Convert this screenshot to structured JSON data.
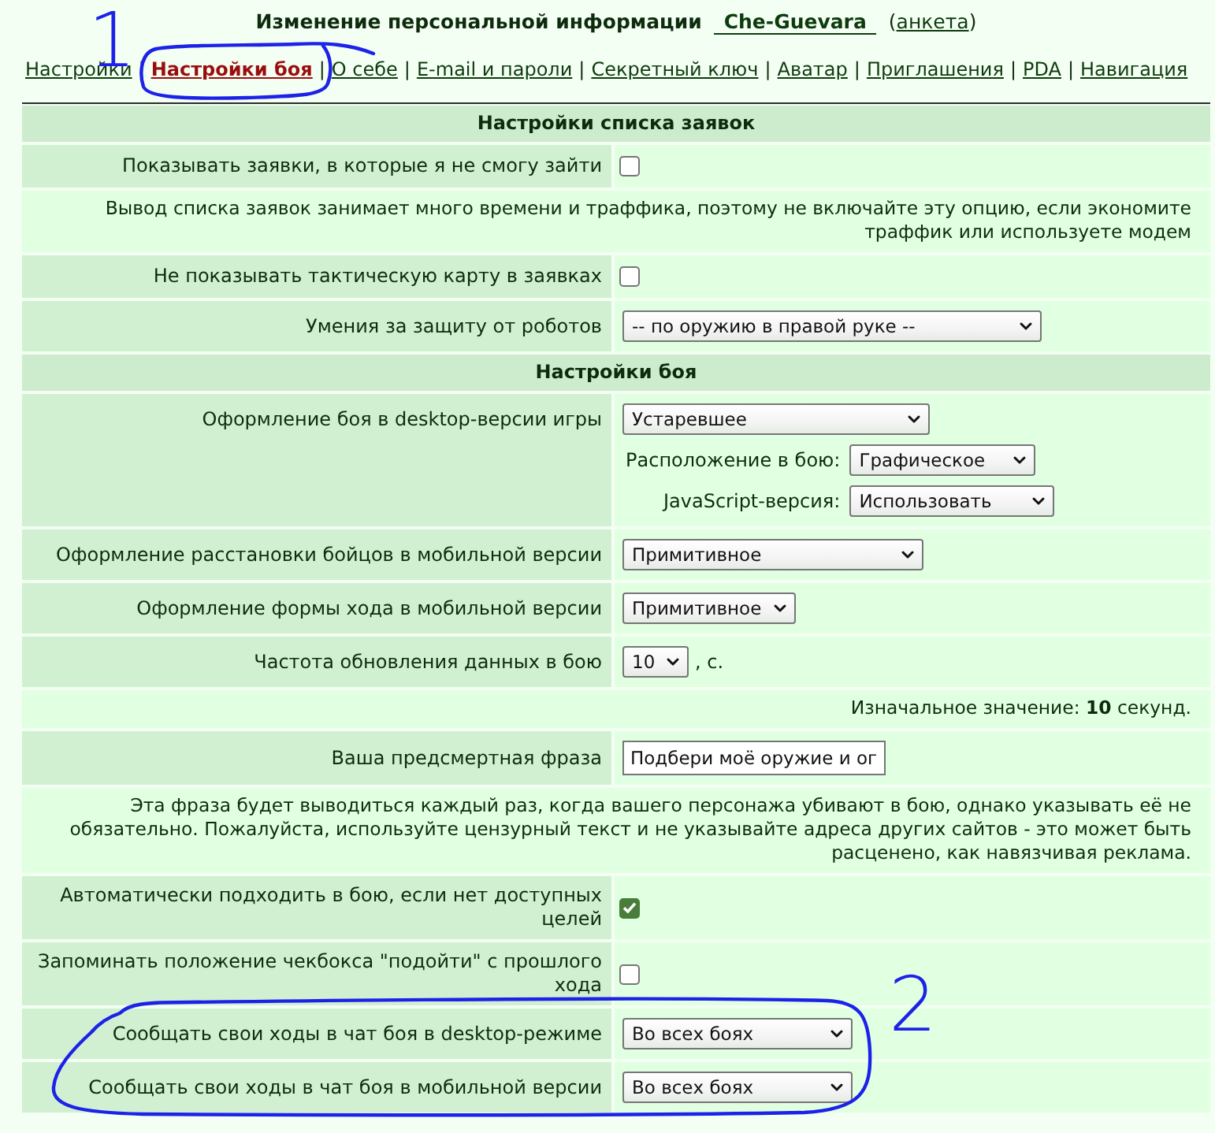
{
  "header": {
    "title": "Изменение персональной информации",
    "user_link": "Che-Guevara",
    "profile": {
      "open": "(",
      "link": "анкета",
      "close": ")"
    }
  },
  "nav": {
    "separator": "|",
    "items": [
      {
        "label": "Настройки",
        "selected": false
      },
      {
        "label": "Настройки боя",
        "selected": true,
        "annotation": "1"
      },
      {
        "label": "О себе",
        "selected": false
      },
      {
        "label": "E-mail и пароли",
        "selected": false
      },
      {
        "label": "Секретный ключ",
        "selected": false
      },
      {
        "label": "Аватар",
        "selected": false
      },
      {
        "label": "Приглашения",
        "selected": false
      },
      {
        "label": "PDA",
        "selected": false
      },
      {
        "label": "Навигация",
        "selected": false
      }
    ]
  },
  "sections": [
    {
      "title": "Настройки списка заявок",
      "rows": [
        {
          "kind": "checkbox",
          "label": "Показывать заявки, в которые я не смогу зайти",
          "checked": false
        },
        {
          "kind": "note",
          "text": "Вывод списка заявок занимает много времени и траффика, поэтому не включайте эту опцию, если экономите траффик или используете модем"
        },
        {
          "kind": "checkbox",
          "label": "Не показывать тактическую карту в заявках",
          "checked": false
        },
        {
          "kind": "select",
          "label": "Умения за защиту от роботов",
          "value": "-- по оружию в правой руке --"
        }
      ]
    },
    {
      "title": "Настройки боя",
      "rows": [
        {
          "kind": "select",
          "label": "Оформление боя в desktop-версии игры",
          "value": "Устаревшее",
          "subfields": [
            {
              "label": "Расположение в бою:",
              "value": "Графическое"
            },
            {
              "label": "JavaScript-версия:",
              "value": "Использовать"
            }
          ]
        },
        {
          "kind": "select",
          "label": "Оформление расстановки бойцов в мобильной версии",
          "value": "Примитивное"
        },
        {
          "kind": "select",
          "label": "Оформление формы хода в мобильной версии",
          "value": "Примитивное"
        },
        {
          "kind": "select",
          "label": "Частота обновления данных в бою",
          "value": "10",
          "suffix": ", с."
        },
        {
          "kind": "note",
          "text": "Изначальное значение: **10** секунд."
        },
        {
          "kind": "text",
          "label": "Ваша предсмертная фраза",
          "value": "Подбери моё оружие и ог"
        },
        {
          "kind": "note",
          "text": "Эта фраза будет выводиться каждый раз, когда вашего персонажа убивают в бою, однако указывать её не обязательно. Пожалуйста, используйте цензурный текст и не указывайте адреса других сайтов - это может быть расценено, как навязчивая реклама."
        },
        {
          "kind": "checkbox",
          "label": "Автоматически подходить в бою, если нет доступных целей",
          "checked": true
        },
        {
          "kind": "checkbox",
          "label": "Запоминать положение чекбокса \"подойти\" с прошлого хода",
          "checked": false
        },
        {
          "kind": "group",
          "annotation": "2",
          "rows": [
            {
              "kind": "select",
              "label": "Сообщать свои ходы в чат боя в desktop-режиме",
              "value": "Во всех боях"
            },
            {
              "kind": "select",
              "label": "Сообщать свои ходы в чат боя в мобильной версии",
              "value": "Во всех боях"
            }
          ]
        }
      ]
    }
  ]
}
